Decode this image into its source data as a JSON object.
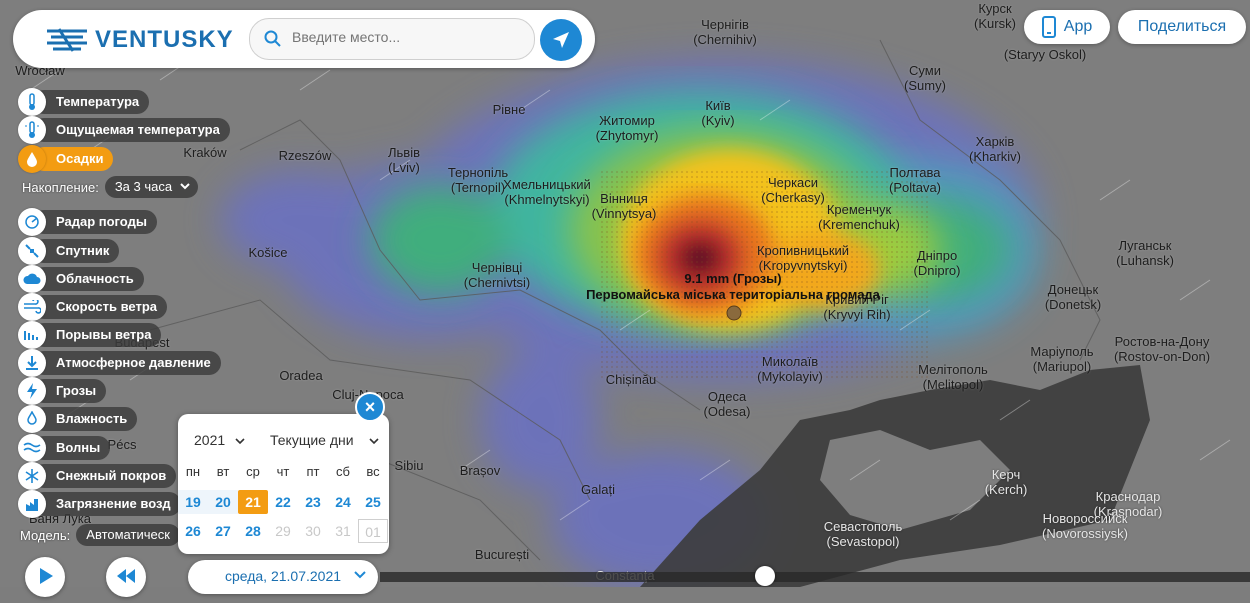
{
  "header": {
    "brand": "VENTUSKY",
    "search_placeholder": "Введите место...",
    "app_label": "App",
    "share_label": "Поделиться"
  },
  "layers": [
    {
      "label": "Температура",
      "icon": "thermometer-icon",
      "active": false
    },
    {
      "label": "Ощущаемая температура",
      "icon": "feels-like-icon",
      "active": false
    },
    {
      "label": "Осадки",
      "icon": "droplet-icon",
      "active": true
    },
    {
      "label": "Радар погоды",
      "icon": "radar-icon",
      "active": false
    },
    {
      "label": "Спутник",
      "icon": "satellite-icon",
      "active": false
    },
    {
      "label": "Облачность",
      "icon": "cloud-icon",
      "active": false
    },
    {
      "label": "Скорость ветра",
      "icon": "wind-icon",
      "active": false
    },
    {
      "label": "Порывы ветра",
      "icon": "gust-icon",
      "active": false
    },
    {
      "label": "Атмосферное давление",
      "icon": "pressure-icon",
      "active": false
    },
    {
      "label": "Грозы",
      "icon": "lightning-icon",
      "active": false
    },
    {
      "label": "Влажность",
      "icon": "humidity-icon",
      "active": false
    },
    {
      "label": "Волны",
      "icon": "waves-icon",
      "active": false
    },
    {
      "label": "Снежный покров",
      "icon": "snowflake-icon",
      "active": false
    },
    {
      "label": "Загрязнение возд",
      "icon": "pollution-icon",
      "active": false
    }
  ],
  "accumulation": {
    "label": "Накопление:",
    "value": "За 3 часа"
  },
  "model": {
    "label": "Модель:",
    "value": "Автоматическ"
  },
  "calendar": {
    "year": "2021",
    "mode": "Текущие дни",
    "weekdays": [
      "пн",
      "вт",
      "ср",
      "чт",
      "пт",
      "сб",
      "вс"
    ],
    "row1": [
      "19",
      "20",
      "21",
      "22",
      "23",
      "24",
      "25"
    ],
    "row2": [
      "26",
      "27",
      "28",
      "29",
      "30",
      "31",
      "01"
    ],
    "selected_day": "21"
  },
  "timeline": {
    "date": "среда, 21.07.2021"
  },
  "info": {
    "value": "9.1 mm (Грозы)",
    "place": "Первомайська міська територіальна громада"
  },
  "cities": [
    {
      "name": "Чернігів",
      "latin": "(Chernihiv)"
    },
    {
      "name": "Курск",
      "latin": "(Kursk)"
    },
    {
      "name": "",
      "latin": "(Staryy Oskol)"
    },
    {
      "name": "Wrocław",
      "latin": ""
    },
    {
      "name": "Київ",
      "latin": "(Kyiv)"
    },
    {
      "name": "Суми",
      "latin": "(Sumy)"
    },
    {
      "name": "Житомир",
      "latin": "(Zhytomyr)"
    },
    {
      "name": "Рівне",
      "latin": ""
    },
    {
      "name": "Харків",
      "latin": "(Kharkiv)"
    },
    {
      "name": "Kraków",
      "latin": ""
    },
    {
      "name": "Rzeszów",
      "latin": ""
    },
    {
      "name": "Львів",
      "latin": "(Lviv)"
    },
    {
      "name": "Тернопіль",
      "latin": "(Ternopil)"
    },
    {
      "name": "Хмельницький",
      "latin": "(Khmelnytskyi)"
    },
    {
      "name": "Вінниця",
      "latin": "(Vinnytsya)"
    },
    {
      "name": "Черкаси",
      "latin": "(Cherkasy)"
    },
    {
      "name": "Полтава",
      "latin": "(Poltava)"
    },
    {
      "name": "Кременчук",
      "latin": "(Kremenchuk)"
    },
    {
      "name": "Кропивницький",
      "latin": "(Kropyvnytskyi)"
    },
    {
      "name": "Дніпро",
      "latin": "(Dnipro)"
    },
    {
      "name": "Луганськ",
      "latin": "(Luhansk)"
    },
    {
      "name": "Košice",
      "latin": ""
    },
    {
      "name": "Чернівці",
      "latin": "(Chernivtsi)"
    },
    {
      "name": "Кривий Ріг",
      "latin": "(Kryvyi Rih)"
    },
    {
      "name": "Донецьк",
      "latin": "(Donetsk)"
    },
    {
      "name": "Budapest",
      "latin": ""
    },
    {
      "name": "Маріуполь",
      "latin": "(Mariupol)"
    },
    {
      "name": "Ростов-на-Дону",
      "latin": "(Rostov-on-Don)"
    },
    {
      "name": "Oradea",
      "latin": ""
    },
    {
      "name": "Chișinău",
      "latin": ""
    },
    {
      "name": "Миколаїв",
      "latin": "(Mykolayiv)"
    },
    {
      "name": "Мелітополь",
      "latin": "(Melitopol)"
    },
    {
      "name": "Cluj-Napoca",
      "latin": ""
    },
    {
      "name": "Одеса",
      "latin": "(Odesa)"
    },
    {
      "name": "Pécs",
      "latin": ""
    },
    {
      "name": "Sibiu",
      "latin": ""
    },
    {
      "name": "Brașov",
      "latin": ""
    },
    {
      "name": "Керч",
      "latin": "(Kerch)"
    },
    {
      "name": "Galați",
      "latin": ""
    },
    {
      "name": "Краснодар",
      "latin": "(Krasnodar)"
    },
    {
      "name": "Новороссийск",
      "latin": "(Novorossiysk)"
    },
    {
      "name": "Севастополь",
      "latin": "(Sevastopol)"
    },
    {
      "name": "București",
      "latin": ""
    },
    {
      "name": "Constanța",
      "latin": ""
    },
    {
      "name": "Баня Лука",
      "latin": ""
    }
  ]
}
